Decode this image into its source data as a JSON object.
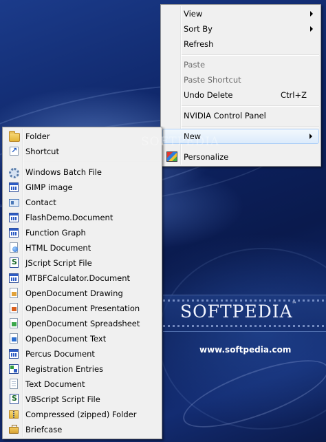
{
  "desktop": {
    "brand": "SOFTPEDIA",
    "trademark": "™",
    "site": "www.softpedia.com",
    "watermark": "SOFTPEDIA"
  },
  "context_menu": {
    "items": [
      {
        "label": "View",
        "submenu": true
      },
      {
        "label": "Sort By",
        "submenu": true
      },
      {
        "label": "Refresh"
      },
      {
        "label": "Paste",
        "disabled": true
      },
      {
        "label": "Paste Shortcut",
        "disabled": true
      },
      {
        "label": "Undo Delete",
        "shortcut": "Ctrl+Z"
      },
      {
        "label": "NVIDIA Control Panel"
      },
      {
        "label": "New",
        "submenu": true,
        "highlighted": true
      },
      {
        "label": "Personalize",
        "icon": "personalize-icon"
      }
    ]
  },
  "new_submenu": {
    "items": [
      {
        "label": "Folder",
        "icon": "folder-icon"
      },
      {
        "label": "Shortcut",
        "icon": "shortcut-icon"
      },
      {
        "label": "Windows Batch File",
        "icon": "batch-file-icon"
      },
      {
        "label": "GIMP image",
        "icon": "gimp-icon"
      },
      {
        "label": "Contact",
        "icon": "contact-icon"
      },
      {
        "label": "FlashDemo.Document",
        "icon": "app-document-icon"
      },
      {
        "label": "Function Graph",
        "icon": "app-document-icon"
      },
      {
        "label": "HTML Document",
        "icon": "html-document-icon"
      },
      {
        "label": "JScript Script File",
        "icon": "script-file-icon"
      },
      {
        "label": "MTBFCalculator.Document",
        "icon": "app-document-icon"
      },
      {
        "label": "OpenDocument Drawing",
        "icon": "odf-drawing-icon"
      },
      {
        "label": "OpenDocument Presentation",
        "icon": "odf-presentation-icon"
      },
      {
        "label": "OpenDocument Spreadsheet",
        "icon": "odf-spreadsheet-icon"
      },
      {
        "label": "OpenDocument Text",
        "icon": "odf-text-icon"
      },
      {
        "label": "Percus Document",
        "icon": "app-document-icon"
      },
      {
        "label": "Registration Entries",
        "icon": "registry-icon"
      },
      {
        "label": "Text Document",
        "icon": "text-document-icon"
      },
      {
        "label": "VBScript Script File",
        "icon": "script-file-icon"
      },
      {
        "label": "Compressed (zipped) Folder",
        "icon": "zip-folder-icon"
      },
      {
        "label": "Briefcase",
        "icon": "briefcase-icon"
      }
    ]
  }
}
